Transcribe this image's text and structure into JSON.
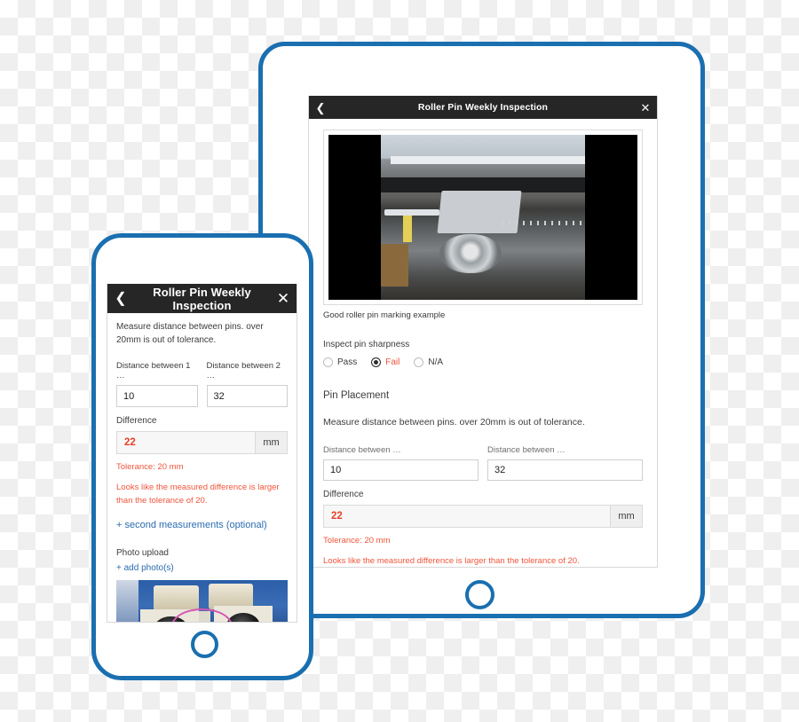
{
  "app": {
    "title": "Roller Pin Weekly Inspection",
    "back_icon": "chevron-left-icon",
    "close_icon": "close-icon"
  },
  "tablet": {
    "photo_caption": "Good roller pin marking example",
    "sharpness": {
      "question": "Inspect pin sharpness",
      "options": [
        {
          "label": "Pass",
          "selected": false
        },
        {
          "label": "Fail",
          "selected": true
        },
        {
          "label": "N/A",
          "selected": false
        }
      ]
    },
    "pin_placement": {
      "section_title": "Pin Placement",
      "instruction": "Measure distance between pins. over 20mm is out of tolerance.",
      "field1_label": "Distance between …",
      "field1_value": "10",
      "field2_label": "Distance between …",
      "field2_value": "32",
      "difference_label": "Difference",
      "difference_value": "22",
      "difference_unit": "mm",
      "tolerance_text": "Tolerance:  20   mm",
      "warning_text": "Looks like the measured difference is larger than the tolerance of 20."
    }
  },
  "phone": {
    "instruction": "Measure distance between pins. over 20mm is out of tolerance.",
    "field1_label": "Distance between 1 …",
    "field1_value": "10",
    "field2_label": "Distance between 2 …",
    "field2_value": "32",
    "difference_label": "Difference",
    "difference_value": "22",
    "difference_unit": "mm",
    "tolerance_text": "Tolerance:  20   mm",
    "warning_text": "Looks like the measured difference is larger than the tolerance of 20.",
    "second_measurements_link": "+ second measurements (optional)",
    "photo_upload_label": "Photo upload",
    "add_photo_link": "+ add photo(s)"
  },
  "colors": {
    "device_frame": "#1a6fb0",
    "titlebar": "#262626",
    "error": "#f0553b",
    "link": "#2b6cb0",
    "highlight_ellipse": "#d457b2"
  }
}
